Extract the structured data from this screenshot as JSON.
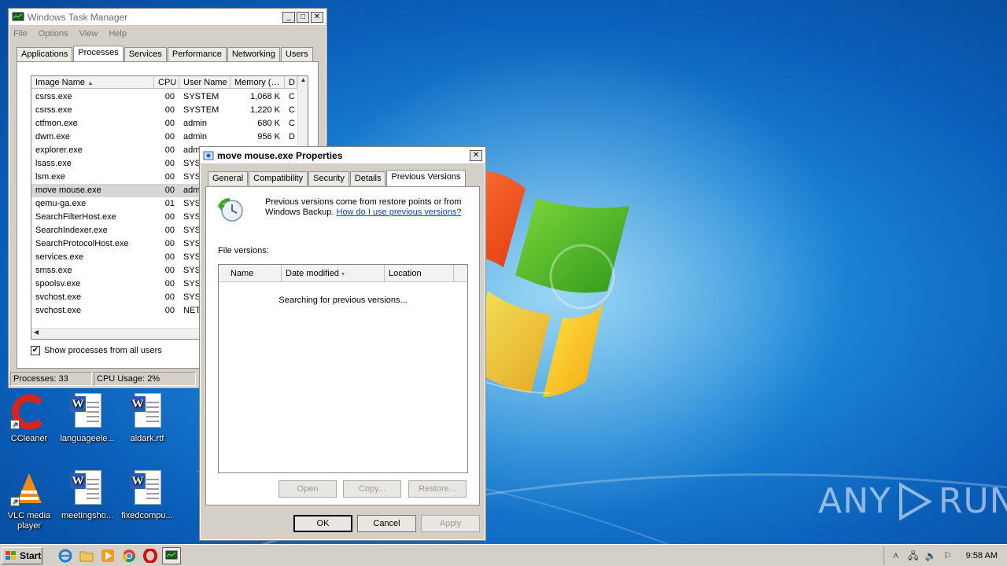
{
  "taskmgr": {
    "title": "Windows Task Manager",
    "menu": [
      "File",
      "Options",
      "View",
      "Help"
    ],
    "tabs": [
      "Applications",
      "Processes",
      "Services",
      "Performance",
      "Networking",
      "Users"
    ],
    "active_tab": "Processes",
    "columns": [
      "Image Name",
      "CPU",
      "User Name",
      "Memory (…",
      "D"
    ],
    "rows": [
      {
        "name": "csrss.exe",
        "cpu": "00",
        "user": "SYSTEM",
        "mem": "1,068 K",
        "d": "C"
      },
      {
        "name": "csrss.exe",
        "cpu": "00",
        "user": "SYSTEM",
        "mem": "1,220 K",
        "d": "C"
      },
      {
        "name": "ctfmon.exe",
        "cpu": "00",
        "user": "admin",
        "mem": "680 K",
        "d": "C"
      },
      {
        "name": "dwm.exe",
        "cpu": "00",
        "user": "admin",
        "mem": "956 K",
        "d": "D"
      },
      {
        "name": "explorer.exe",
        "cpu": "00",
        "user": "adm",
        "mem": "",
        "d": ""
      },
      {
        "name": "lsass.exe",
        "cpu": "00",
        "user": "SYS",
        "mem": "",
        "d": ""
      },
      {
        "name": "lsm.exe",
        "cpu": "00",
        "user": "SYS",
        "mem": "",
        "d": ""
      },
      {
        "name": "move mouse.exe",
        "cpu": "00",
        "user": "adm",
        "mem": "",
        "d": ""
      },
      {
        "name": "qemu-ga.exe",
        "cpu": "01",
        "user": "SYS",
        "mem": "",
        "d": ""
      },
      {
        "name": "SearchFilterHost.exe",
        "cpu": "00",
        "user": "SYS",
        "mem": "",
        "d": ""
      },
      {
        "name": "SearchIndexer.exe",
        "cpu": "00",
        "user": "SYS",
        "mem": "",
        "d": ""
      },
      {
        "name": "SearchProtocolHost.exe",
        "cpu": "00",
        "user": "SYS",
        "mem": "",
        "d": ""
      },
      {
        "name": "services.exe",
        "cpu": "00",
        "user": "SYS",
        "mem": "",
        "d": ""
      },
      {
        "name": "smss.exe",
        "cpu": "00",
        "user": "SYS",
        "mem": "",
        "d": ""
      },
      {
        "name": "spoolsv.exe",
        "cpu": "00",
        "user": "SYS",
        "mem": "",
        "d": ""
      },
      {
        "name": "svchost.exe",
        "cpu": "00",
        "user": "SYS",
        "mem": "",
        "d": ""
      },
      {
        "name": "svchost.exe",
        "cpu": "00",
        "user": "NET",
        "mem": "",
        "d": ""
      }
    ],
    "show_all_label": "Show processes from all users",
    "show_all_checked": true,
    "status_processes": "Processes: 33",
    "status_cpu": "CPU Usage: 2%"
  },
  "props": {
    "title": "move mouse.exe Properties",
    "tabs": [
      "General",
      "Compatibility",
      "Security",
      "Details",
      "Previous Versions"
    ],
    "active_tab": "Previous Versions",
    "intro_line1": "Previous versions come from restore points or from",
    "intro_line2": "Windows Backup.",
    "help_link": "How do I use previous versions?",
    "file_versions_label": "File versions:",
    "columns": [
      "Name",
      "Date modified",
      "Location"
    ],
    "searching_text": "Searching for previous versions...",
    "open_btn": "Open",
    "copy_btn": "Copy...",
    "restore_btn": "Restore...",
    "ok_btn": "OK",
    "cancel_btn": "Cancel",
    "apply_btn": "Apply"
  },
  "desktop_icons": [
    {
      "label": "CCleaner",
      "icon": "ccleaner-icon"
    },
    {
      "label": "languageele...",
      "icon": "word-document-icon"
    },
    {
      "label": "aldark.rtf",
      "icon": "word-document-icon"
    },
    {
      "label": "VLC media player",
      "icon": "vlc-icon"
    },
    {
      "label": "meetingsho...",
      "icon": "word-document-icon"
    },
    {
      "label": "fixedcompu...",
      "icon": "word-document-icon"
    }
  ],
  "taskbar": {
    "start_label": "Start",
    "clock": "9:58 AM"
  },
  "watermark": {
    "left": "ANY",
    "right": "RUN"
  },
  "colors": {
    "selection": "#d6d6d6",
    "link": "#0b43a6",
    "window_face": "#d4d0c8",
    "desktop": "#1c86d6"
  }
}
